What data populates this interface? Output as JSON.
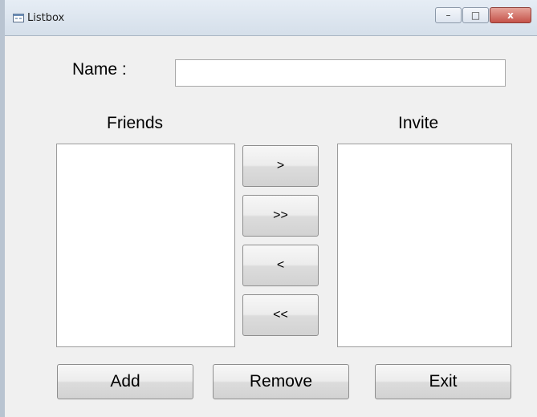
{
  "window": {
    "title": "Listbox",
    "controls": {
      "minimize": "–",
      "maximize": "□",
      "close": "x"
    }
  },
  "form": {
    "name_label": "Name :",
    "name_value": "",
    "friends_label": "Friends",
    "invite_label": "Invite",
    "friends_items": [],
    "invite_items": [],
    "move_buttons": {
      "move_one_right": ">",
      "move_all_right": ">>",
      "move_one_left": "<",
      "move_all_left": "<<"
    },
    "bottom_buttons": {
      "add": "Add",
      "remove": "Remove",
      "exit": "Exit"
    }
  },
  "icons": {
    "app_icon": "form-window-icon"
  }
}
